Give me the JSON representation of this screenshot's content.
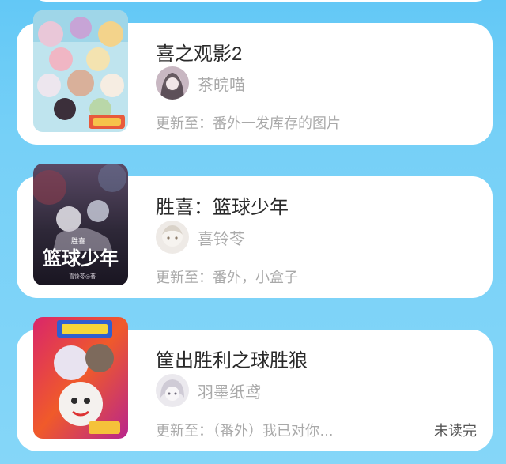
{
  "books": [
    {
      "title": "喜之观影2",
      "author": "茶皖喵",
      "update": "更新至：番外一发库存的图片",
      "status": "",
      "cover_icon": "book-cover-colorful-characters"
    },
    {
      "title": "胜喜：篮球少年",
      "author": "喜铃苓",
      "update": "更新至：番外，小盒子",
      "status": "",
      "cover_text": "篮球少年",
      "cover_subtitle": "胜喜",
      "cover_byline": "喜铃苓◎著"
    },
    {
      "title": "筐出胜利之球胜狼",
      "author": "羽墨纸鸢",
      "update": "更新至：（番外）我已对你…",
      "status": "未读完"
    }
  ]
}
